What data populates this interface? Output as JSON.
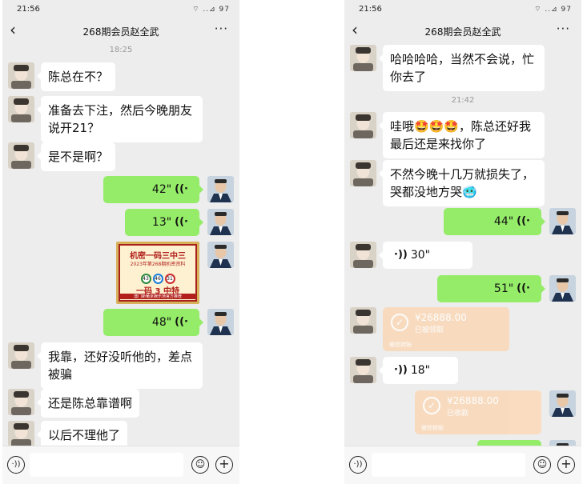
{
  "common": {
    "time": "21:56",
    "status_icons": "⌔ ..⊿ 97",
    "title": "268期会员赵全武",
    "back_icon": "‹",
    "more_icon": "···"
  },
  "left": {
    "timestamp": "18:25",
    "msg1": "陈总在不？",
    "msg2": "准备去下注，然后今晚朋友说开21？",
    "msg3": "是不是啊？",
    "voice1": "42\"",
    "voice2": "13\"",
    "poster": {
      "line1": "机密一码三中三",
      "line2": "2023年第268期机密资料",
      "balls": [
        "43",
        "46",
        "31"
      ],
      "line3": "一码 3 中特",
      "line4": "澳门新葡京娱乐场官方推荐"
    },
    "voice3": "48\"",
    "msg4": "我靠，还好没听他的，差点被骗",
    "msg5": "还是陈总靠谱啊",
    "msg6": "以后不理他了"
  },
  "right": {
    "msg1": "哈哈哈哈，当然不会说，忙你去了",
    "timestamp": "21:42",
    "msg2": "哇哦🤩🤩🤩，陈总还好我最后还是来找你了",
    "msg3": "不然今晚十几万就损失了，哭都没地方哭🥶",
    "voice1": "44\"",
    "voice_in1": "30\"",
    "voice2": "51\"",
    "transfer1": {
      "amount": "¥26888.00",
      "status": "已被领取",
      "footer": "微信转账"
    },
    "voice_in2": "18\"",
    "transfer2": {
      "amount": "¥26888.00",
      "status": "已收款",
      "footer": "微信转账"
    }
  }
}
